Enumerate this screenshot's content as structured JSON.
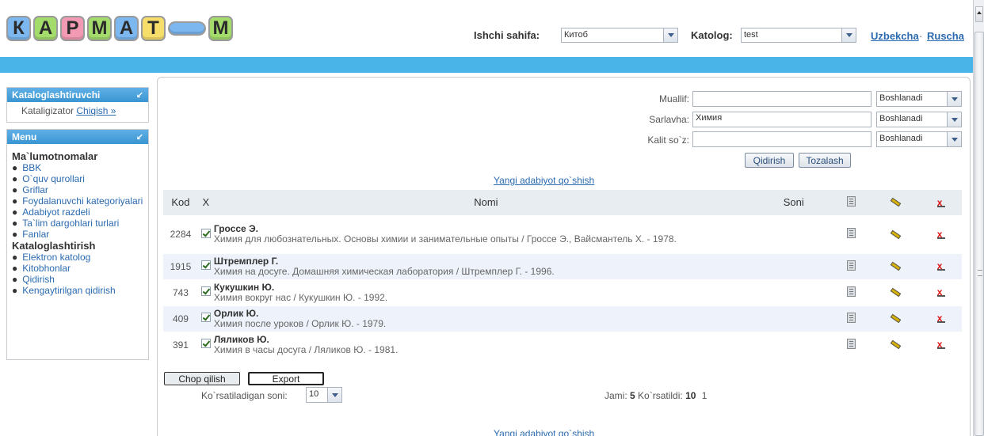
{
  "header": {
    "logo_letters": [
      "К",
      "А",
      "Р",
      "М",
      "А",
      "Т",
      "",
      "М"
    ],
    "ishchi_label": "Ishchi sahifa:",
    "ishchi_value": "Китоб",
    "katolog_label": "Katolog:",
    "katolog_value": "test",
    "lang_uz": "Uzbekcha",
    "lang_sep": "·",
    "lang_ru": "Ruscha"
  },
  "sidebar": {
    "kat_title": "Kataloglashtiruvchi",
    "kat_user": "Kataligizator",
    "kat_exit": "Chiqish »",
    "menu_title": "Menu",
    "groups": [
      {
        "title": "Ma`lumotnomalar",
        "items": [
          "BBK",
          "O`quv qurollari",
          "Griflar",
          "Foydalanuvchi kategoriyalari",
          "Adabiyot razdeli",
          "Ta`lim dargohlari turlari",
          "Fanlar"
        ]
      },
      {
        "title": "Kataloglashtirish",
        "items": [
          "Elektron katolog",
          "Kitobhonlar",
          "Qidirish",
          "Kengaytirilgan qidirish"
        ]
      }
    ]
  },
  "search": {
    "muallif_label": "Muallif:",
    "muallif_value": "",
    "sarlavha_label": "Sarlavha:",
    "sarlavha_value": "Химия",
    "kalit_label": "Kalit so`z:",
    "kalit_value": "",
    "mode_value": "Boshlanadi",
    "search_btn": "Qidirish",
    "clear_btn": "Tozalash"
  },
  "add_link": "Yangi adabiyot qo`shish",
  "table": {
    "headers": {
      "kod": "Kod",
      "x": "X",
      "nomi": "Nomi",
      "soni": "Soni"
    },
    "rows": [
      {
        "kod": "2284",
        "author": "Гроссе Э.",
        "title": "Химия для любознательных. Основы химии и занимательные опыты / Гроссе Э., Вайсмантель Х. - 1978.",
        "soni": ""
      },
      {
        "kod": "1915",
        "author": "Штремплер Г.",
        "title": "Химия на досуге. Домашняя химическая лаборатория / Штремплер Г. - 1996.",
        "soni": ""
      },
      {
        "kod": "743",
        "author": "Кукушкин Ю.",
        "title": "Химия вокруг нас / Кукушкин Ю. - 1992.",
        "soni": ""
      },
      {
        "kod": "409",
        "author": "Орлик Ю.",
        "title": "Химия после уроков / Орлик Ю. - 1979.",
        "soni": ""
      },
      {
        "kod": "391",
        "author": "Ляликов Ю.",
        "title": "Химия в часы досуга / Ляликов Ю. - 1981.",
        "soni": ""
      }
    ]
  },
  "footer": {
    "print_btn": "Chop qilish",
    "export_btn": "Export",
    "count_label": "Ko`rsatiladigan soni:",
    "count_value": "10",
    "jami_label": "Jami:",
    "jami_value": "5",
    "shown_label": "Ko`rsatildi:",
    "shown_value": "10",
    "page": "1",
    "add_link_bottom": "Yangi adabiyot qo`shish"
  }
}
